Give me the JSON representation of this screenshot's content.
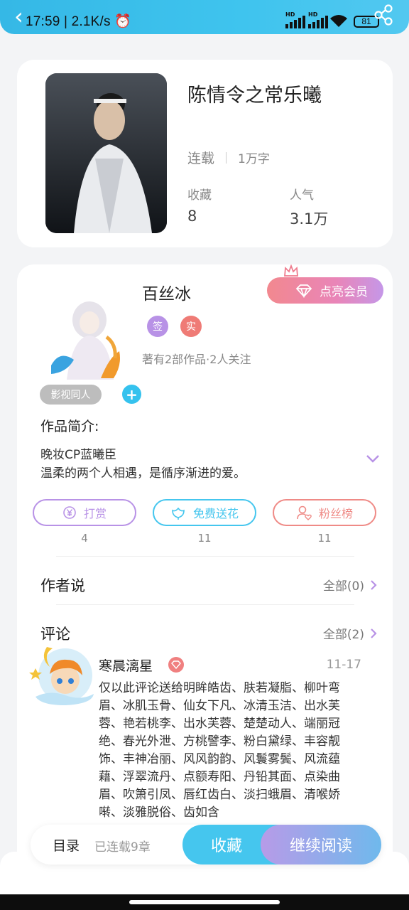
{
  "status_bar": {
    "time": "17:59",
    "net_speed": "2.1K/s",
    "battery": "81",
    "hd_label": "HD"
  },
  "book": {
    "title": "陈情令之常乐曦",
    "status": "连载",
    "word_count": "1万字",
    "favorites_label": "收藏",
    "favorites_value": "8",
    "popularity_label": "人气",
    "popularity_value": "3.1万"
  },
  "author": {
    "name": "百丝冰",
    "vip_button": "点亮会员",
    "badge_signed": "签",
    "badge_real": "实",
    "works_info": "著有2部作品·2人关注"
  },
  "tags": [
    "影视同人"
  ],
  "intro": {
    "label": "作品简介:",
    "line1": "晚妆CP蓝曦臣",
    "line2": "温柔的两个人相遇，是循序渐进的爱。"
  },
  "actions": [
    {
      "label": "打赏",
      "count": "4",
      "color": "#b892e6"
    },
    {
      "label": "免费送花",
      "count": "11",
      "color": "#45c6ee"
    },
    {
      "label": "粉丝榜",
      "count": "11",
      "color": "#ef8a86"
    }
  ],
  "author_says": {
    "title": "作者说",
    "more": "全部(0)"
  },
  "comments": {
    "title": "评论",
    "more": "全部(2)",
    "first": {
      "name": "寒晨漓星",
      "date": "11-17",
      "text": "仅以此评论送给明眸皓齿、肤若凝脂、柳叶弯眉、冰肌玉骨、仙女下凡、冰清玉洁、出水芙蓉、艳若桃李、出水芙蓉、楚楚动人、端丽冠绝、春光外泄、方桃譬李、粉白黛绿、丰容靓饰、丰神冶丽、风风韵韵、风鬟雾鬓、风流蕴藉、浮翠流丹、点额寿阳、丹铅其面、点染曲眉、吹箫引凤、唇红齿白、淡扫蛾眉、清喉娇啭、淡雅脱俗、齿如含"
    }
  },
  "bottom_bar": {
    "toc": "目录",
    "serial": "已连载9章",
    "favorite": "收藏",
    "continue": "继续阅读"
  },
  "colors": {
    "accent_blue": "#45c6ee",
    "accent_purple": "#b892e6",
    "accent_red": "#ef8a86"
  }
}
